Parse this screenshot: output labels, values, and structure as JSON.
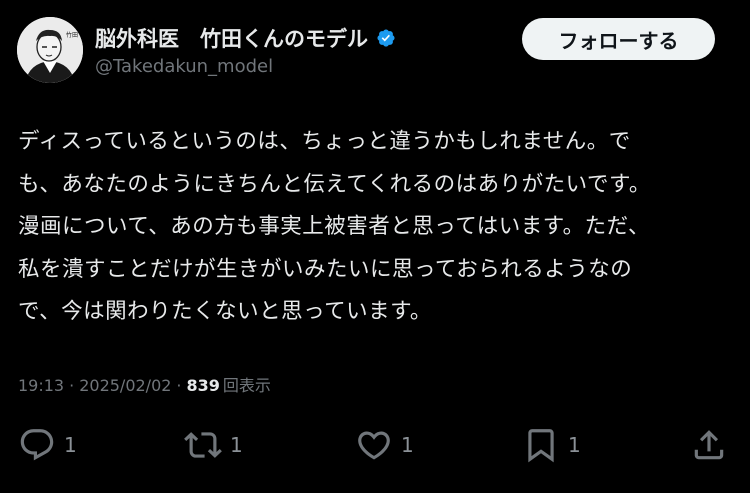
{
  "author": {
    "display_name": "脳外科医　竹田くんのモデル",
    "handle": "@Takedakun_model",
    "verified": true,
    "avatar_icon": "cartoon-doctor-avatar",
    "avatar_text": "竹田くん"
  },
  "follow_button": {
    "label": "フォローする"
  },
  "tweet": {
    "lines": [
      "ディスっているというのは、ちょっと違うかもしれません。で",
      "も、あなたのようにきちんと伝えてくれるのはありがたいです。",
      "漫画について、あの方も事実上被害者と思ってはいます。ただ、",
      "私を潰すことだけが生きがいみたいに思っておられるようなの",
      "で、今は関わりたくないと思っています。"
    ]
  },
  "meta": {
    "time": "19:13",
    "separator": "·",
    "date": "2025/02/02",
    "views_count": "839",
    "views_label": "回表示"
  },
  "actions": {
    "reply": {
      "icon": "reply-icon",
      "count": "1"
    },
    "retweet": {
      "icon": "retweet-icon",
      "count": "1"
    },
    "like": {
      "icon": "heart-icon",
      "count": "1"
    },
    "bookmark": {
      "icon": "bookmark-icon",
      "count": "1"
    },
    "share": {
      "icon": "share-icon"
    }
  },
  "colors": {
    "background": "#000000",
    "text_primary": "#e7e9ea",
    "text_secondary": "#71767b",
    "verified_blue": "#1d9bf0",
    "button_bg": "#eff3f4"
  }
}
